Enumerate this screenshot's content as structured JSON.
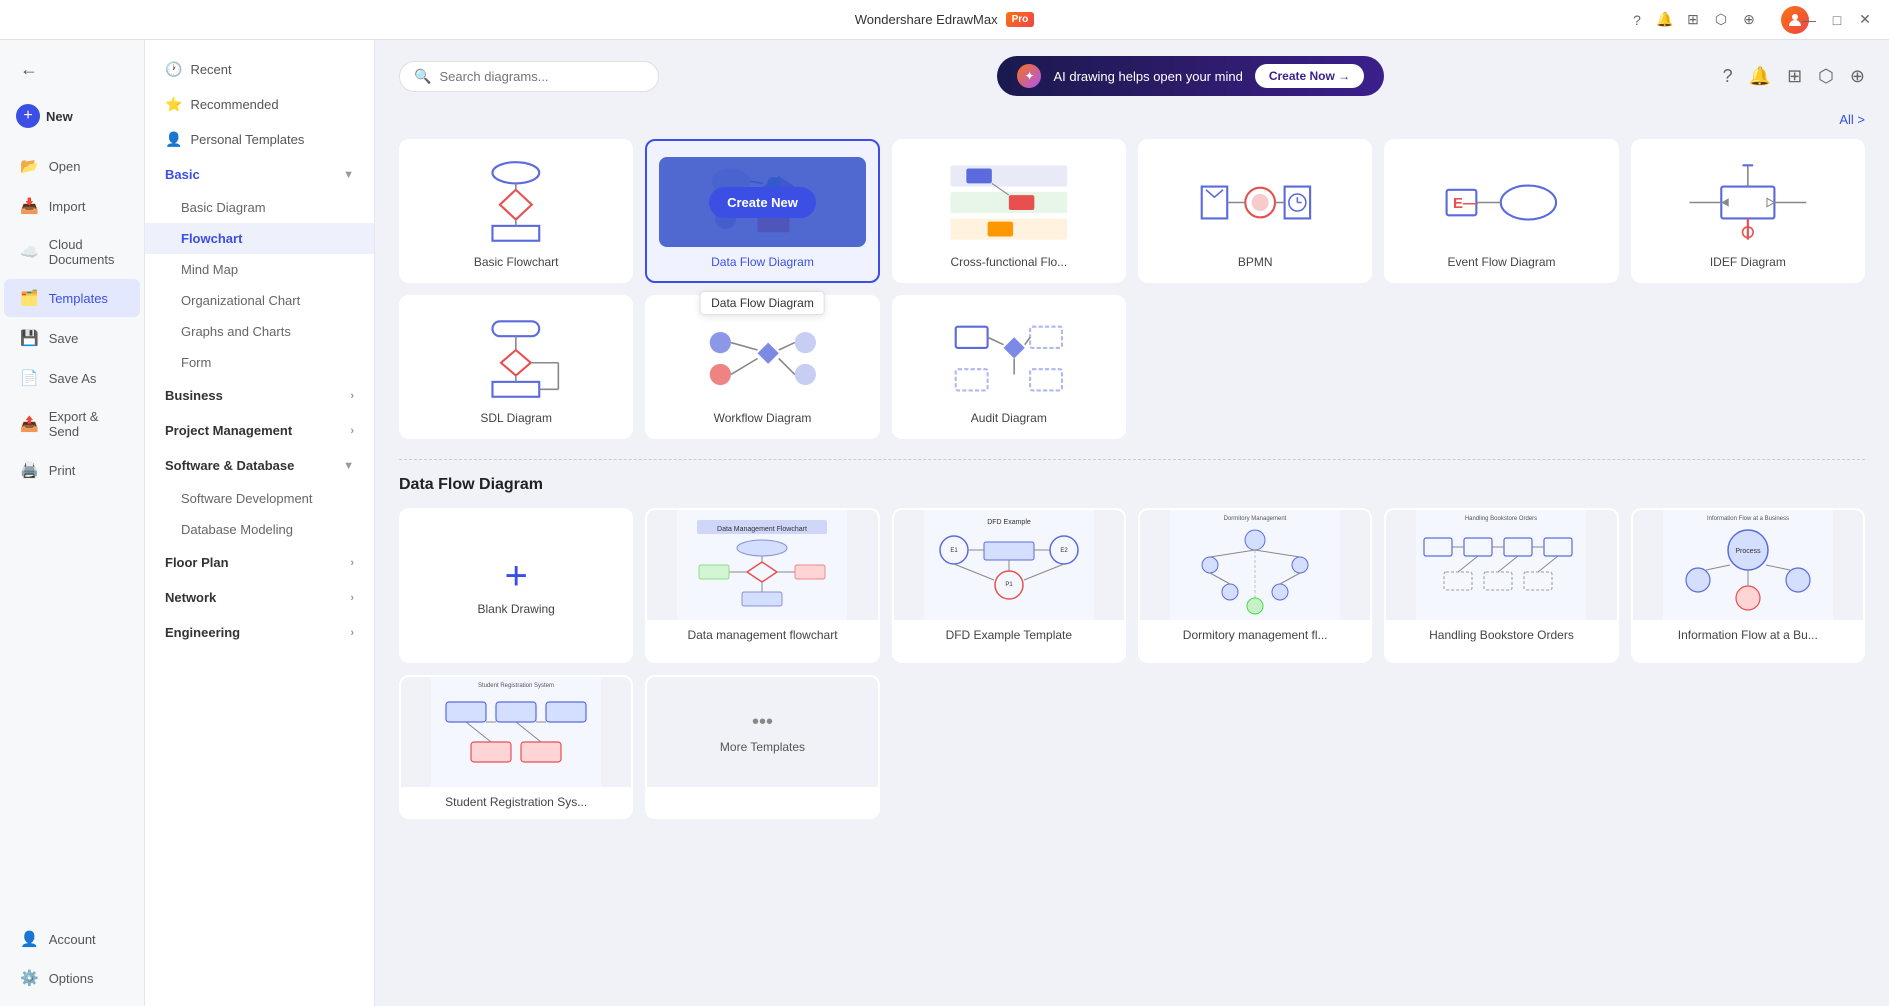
{
  "app": {
    "title": "Wondershare EdrawMax",
    "pro_badge": "Pro"
  },
  "titlebar": {
    "minimize": "—",
    "maximize": "□",
    "close": "✕"
  },
  "left_nav": {
    "new_label": "New",
    "items": [
      {
        "id": "open",
        "label": "Open",
        "icon": "📂"
      },
      {
        "id": "import",
        "label": "Import",
        "icon": "📥"
      },
      {
        "id": "cloud",
        "label": "Cloud Documents",
        "icon": "☁️"
      },
      {
        "id": "templates",
        "label": "Templates",
        "icon": "🗂️"
      },
      {
        "id": "save",
        "label": "Save",
        "icon": "💾"
      },
      {
        "id": "saveas",
        "label": "Save As",
        "icon": "📄"
      },
      {
        "id": "export",
        "label": "Export & Send",
        "icon": "📤"
      },
      {
        "id": "print",
        "label": "Print",
        "icon": "🖨️"
      }
    ],
    "bottom_items": [
      {
        "id": "account",
        "label": "Account",
        "icon": "👤"
      },
      {
        "id": "options",
        "label": "Options",
        "icon": "⚙️"
      }
    ]
  },
  "mid_sidebar": {
    "top_items": [
      {
        "id": "recent",
        "label": "Recent",
        "icon": "🕐"
      },
      {
        "id": "recommended",
        "label": "Recommended",
        "icon": "⭐"
      },
      {
        "id": "personal",
        "label": "Personal Templates",
        "icon": "👤"
      }
    ],
    "sections": [
      {
        "id": "basic",
        "label": "Basic",
        "expanded": true,
        "active": true,
        "children": [
          {
            "id": "basic-diagram",
            "label": "Basic Diagram"
          },
          {
            "id": "flowchart",
            "label": "Flowchart",
            "active": true
          },
          {
            "id": "mind-map",
            "label": "Mind Map"
          },
          {
            "id": "org-chart",
            "label": "Organizational Chart"
          },
          {
            "id": "graphs",
            "label": "Graphs and Charts"
          },
          {
            "id": "form",
            "label": "Form"
          }
        ]
      },
      {
        "id": "business",
        "label": "Business",
        "expanded": false,
        "children": []
      },
      {
        "id": "project",
        "label": "Project Management",
        "expanded": false,
        "children": []
      },
      {
        "id": "software",
        "label": "Software & Database",
        "expanded": true,
        "children": [
          {
            "id": "sw-dev",
            "label": "Software Development"
          },
          {
            "id": "db-model",
            "label": "Database Modeling"
          }
        ]
      },
      {
        "id": "floorplan",
        "label": "Floor Plan",
        "expanded": false,
        "children": []
      },
      {
        "id": "network",
        "label": "Network",
        "expanded": false,
        "children": []
      },
      {
        "id": "engineering",
        "label": "Engineering",
        "expanded": false,
        "children": []
      }
    ]
  },
  "search": {
    "placeholder": "Search diagrams..."
  },
  "ai_banner": {
    "text": "AI drawing helps open your mind",
    "button": "Create Now →"
  },
  "all_link": "All >",
  "diagram_cards": [
    {
      "id": "basic-flowchart",
      "label": "Basic Flowchart",
      "selected": false
    },
    {
      "id": "data-flow",
      "label": "Data Flow Diagram",
      "selected": true,
      "tooltip": "Data Flow Diagram"
    },
    {
      "id": "cross-functional",
      "label": "Cross-functional Flo...",
      "selected": false
    },
    {
      "id": "bpmn",
      "label": "BPMN",
      "selected": false
    },
    {
      "id": "event-flow",
      "label": "Event Flow Diagram",
      "selected": false
    },
    {
      "id": "idef",
      "label": "IDEF Diagram",
      "selected": false
    },
    {
      "id": "sdl",
      "label": "SDL Diagram",
      "selected": false
    },
    {
      "id": "workflow",
      "label": "Workflow Diagram",
      "selected": false
    },
    {
      "id": "audit",
      "label": "Audit Diagram",
      "selected": false
    }
  ],
  "section_title": "Data Flow Diagram",
  "templates": [
    {
      "id": "blank",
      "label": "Blank Drawing",
      "type": "blank"
    },
    {
      "id": "tpl1",
      "label": "Data management flowchart",
      "type": "image"
    },
    {
      "id": "tpl2",
      "label": "DFD Example Template",
      "type": "image"
    },
    {
      "id": "tpl3",
      "label": "Dormitory management fl...",
      "type": "image"
    },
    {
      "id": "tpl4",
      "label": "Handling Bookstore Orders",
      "type": "image"
    },
    {
      "id": "tpl5",
      "label": "",
      "type": "image"
    },
    {
      "id": "tpl6",
      "label": "",
      "type": "image"
    },
    {
      "id": "more",
      "label": "More Templates",
      "type": "more"
    }
  ]
}
